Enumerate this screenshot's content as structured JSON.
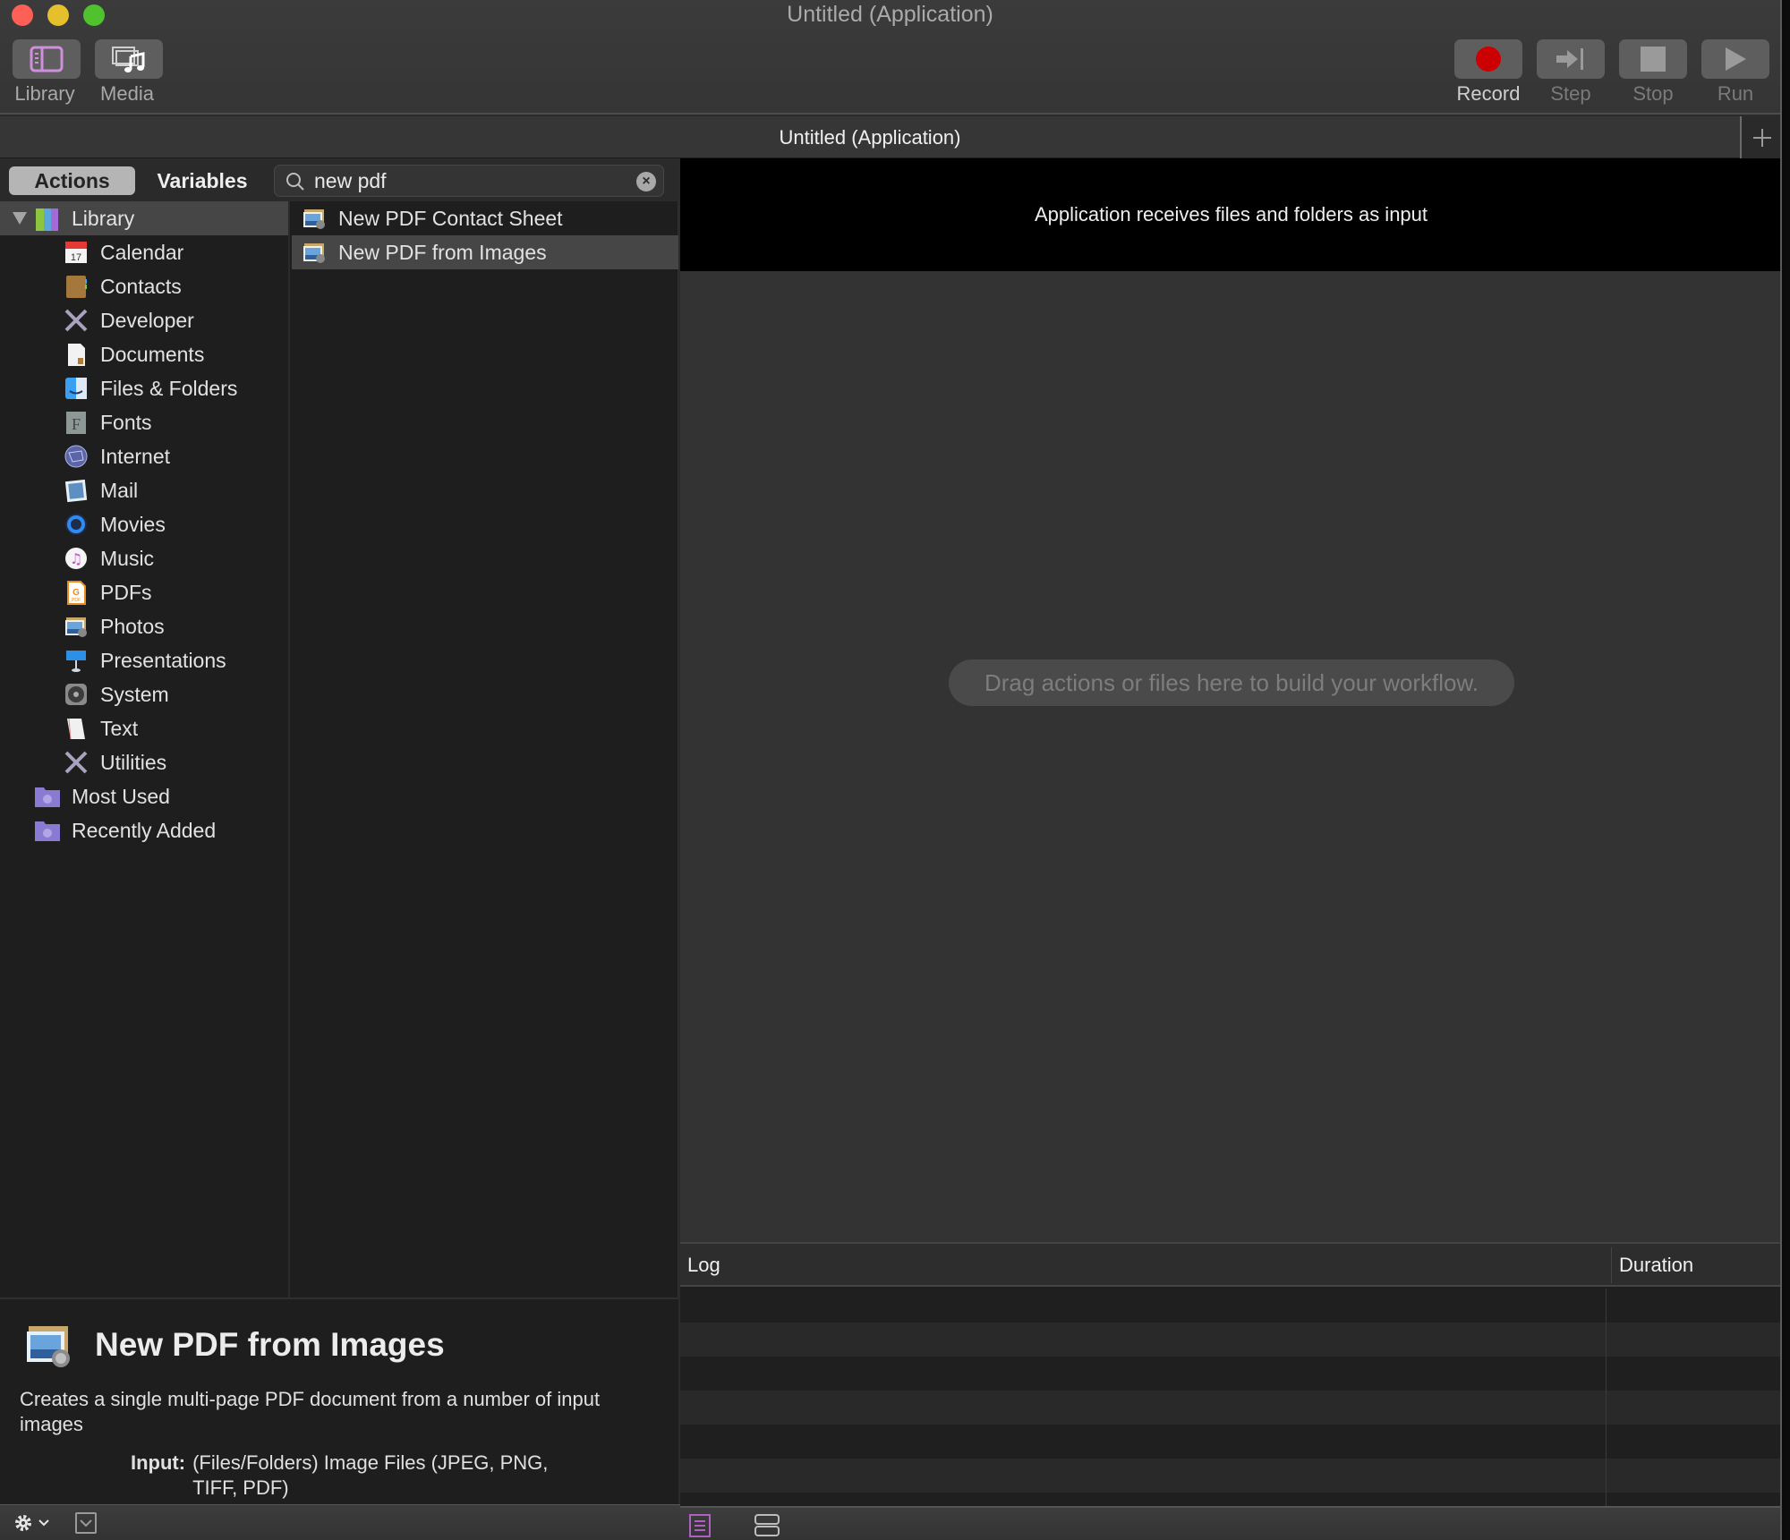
{
  "window": {
    "title": "Untitled (Application)",
    "traffic_lights": [
      "close",
      "minimize",
      "zoom"
    ]
  },
  "toolbar": {
    "left_buttons": [
      {
        "label": "Library",
        "icon": "library-sidebar-icon"
      },
      {
        "label": "Media",
        "icon": "media-icon"
      }
    ],
    "right_buttons": [
      {
        "label": "Record",
        "icon": "record-icon",
        "enabled": true
      },
      {
        "label": "Step",
        "icon": "step-icon",
        "enabled": false
      },
      {
        "label": "Stop",
        "icon": "stop-icon",
        "enabled": false
      },
      {
        "label": "Run",
        "icon": "run-icon",
        "enabled": false
      }
    ],
    "record_color": "#cc0000"
  },
  "document_tab": {
    "label": "Untitled (Application)",
    "add_tab": "+"
  },
  "left_pane": {
    "segments": {
      "actions": "Actions",
      "variables": "Variables",
      "selected": "Actions"
    },
    "search": {
      "value": "new pdf",
      "placeholder": "",
      "clear": "×"
    },
    "library": {
      "root": {
        "label": "Library",
        "expanded": true,
        "icon": "library-icon"
      },
      "items": [
        {
          "label": "Calendar",
          "icon": "calendar-icon"
        },
        {
          "label": "Contacts",
          "icon": "contacts-icon"
        },
        {
          "label": "Developer",
          "icon": "developer-tools-icon"
        },
        {
          "label": "Documents",
          "icon": "documents-icon"
        },
        {
          "label": "Files & Folders",
          "icon": "finder-icon"
        },
        {
          "label": "Fonts",
          "icon": "fonts-icon"
        },
        {
          "label": "Internet",
          "icon": "internet-icon"
        },
        {
          "label": "Mail",
          "icon": "mail-icon"
        },
        {
          "label": "Movies",
          "icon": "movies-icon"
        },
        {
          "label": "Music",
          "icon": "music-icon"
        },
        {
          "label": "PDFs",
          "icon": "pdf-icon"
        },
        {
          "label": "Photos",
          "icon": "photos-icon"
        },
        {
          "label": "Presentations",
          "icon": "presentations-icon"
        },
        {
          "label": "System",
          "icon": "system-icon"
        },
        {
          "label": "Text",
          "icon": "text-icon"
        },
        {
          "label": "Utilities",
          "icon": "utilities-icon"
        }
      ],
      "smart_groups": [
        {
          "label": "Most Used",
          "icon": "smart-folder-icon"
        },
        {
          "label": "Recently Added",
          "icon": "smart-folder-icon"
        }
      ]
    },
    "actions": [
      {
        "label": "New PDF Contact Sheet",
        "selected": false
      },
      {
        "label": "New PDF from Images",
        "selected": true
      }
    ],
    "description": {
      "title": "New PDF from Images",
      "text": "Creates a single multi-page PDF document from a number of input images",
      "input_label": "Input:",
      "input_value": "(Files/Folders) Image Files (JPEG, PNG, TIFF, PDF)"
    },
    "bottom_bar": {
      "gear": "action-menu",
      "collapse": "hide-description"
    }
  },
  "workflow": {
    "header": "Application receives files and folders as input",
    "placeholder": "Drag actions or files here to build your workflow."
  },
  "log": {
    "columns": [
      "Log",
      "Duration"
    ],
    "rows": []
  },
  "colors": {
    "accent_purple": "#b05fc2",
    "record_red": "#cc0000"
  }
}
